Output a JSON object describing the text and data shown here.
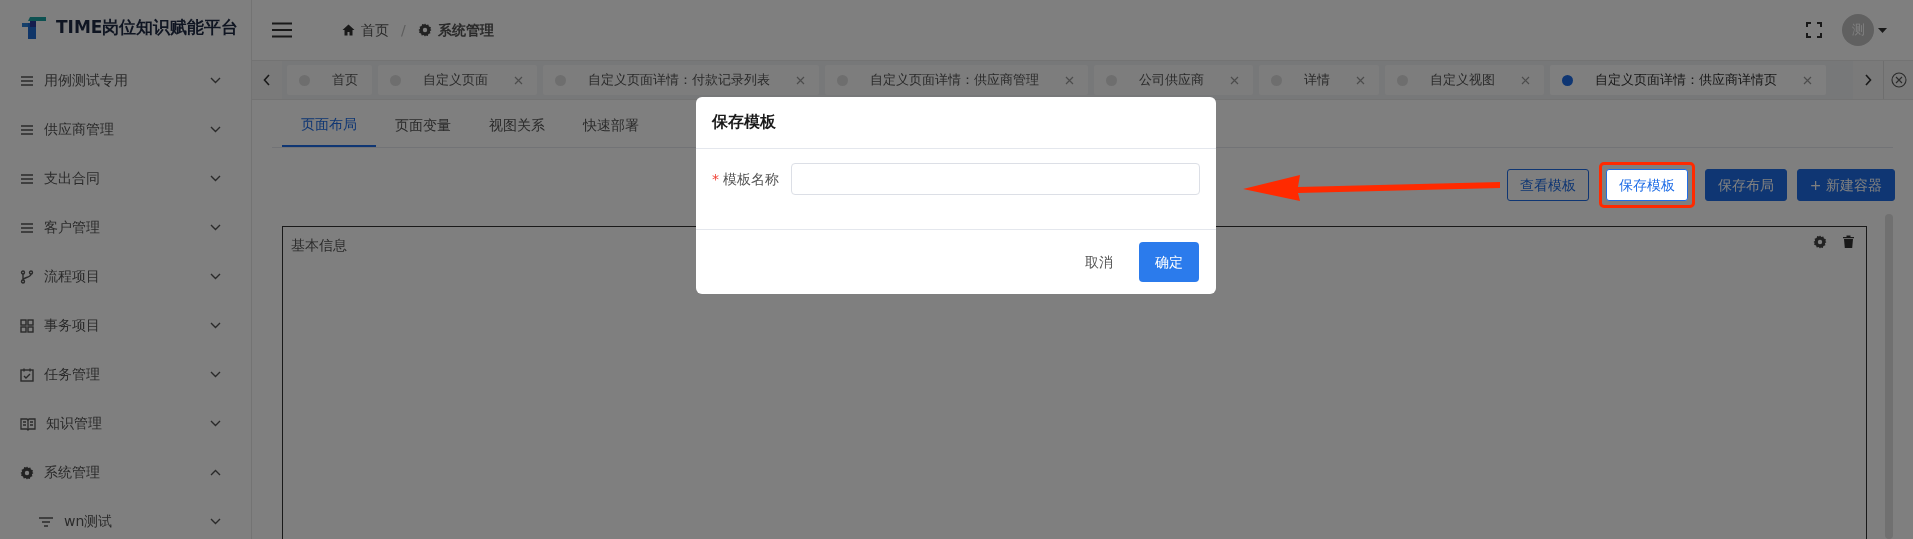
{
  "app": {
    "title": "TIME岗位知识赋能平台"
  },
  "sidebar": {
    "items": [
      {
        "label": "用例测试专用",
        "kind": "menu",
        "expanded": false
      },
      {
        "label": "供应商管理",
        "kind": "menu",
        "expanded": false
      },
      {
        "label": "支出合同",
        "kind": "menu",
        "expanded": false
      },
      {
        "label": "客户管理",
        "kind": "menu",
        "expanded": false
      },
      {
        "label": "流程项目",
        "kind": "branch",
        "expanded": false
      },
      {
        "label": "事务项目",
        "kind": "grid",
        "expanded": false
      },
      {
        "label": "任务管理",
        "kind": "calendar",
        "expanded": false
      },
      {
        "label": "知识管理",
        "kind": "book",
        "expanded": false
      },
      {
        "label": "系统管理",
        "kind": "gear",
        "expanded": true,
        "children": [
          {
            "label": "wn测试",
            "kind": "filter",
            "expanded": false
          }
        ]
      }
    ]
  },
  "breadcrumb": {
    "separator": "/",
    "items": [
      {
        "label": "首页",
        "kind": "home"
      },
      {
        "label": "系统管理",
        "kind": "gear"
      }
    ]
  },
  "user": {
    "avatar_text": "测"
  },
  "page_tabs": [
    {
      "label": "首页",
      "closable": false,
      "selected": false
    },
    {
      "label": "自定义页面",
      "closable": true,
      "selected": false
    },
    {
      "label": "自定义页面详情：付款记录列表",
      "closable": true,
      "selected": false
    },
    {
      "label": "自定义页面详情：供应商管理",
      "closable": true,
      "selected": false
    },
    {
      "label": "公司供应商",
      "closable": true,
      "selected": false
    },
    {
      "label": "详情",
      "closable": true,
      "selected": false
    },
    {
      "label": "自定义视图",
      "closable": true,
      "selected": false
    },
    {
      "label": "自定义页面详情：供应商详情页",
      "closable": true,
      "selected": true
    }
  ],
  "sub_tabs": [
    {
      "label": "页面布局",
      "selected": true
    },
    {
      "label": "页面变量",
      "selected": false
    },
    {
      "label": "视图关系",
      "selected": false
    },
    {
      "label": "快速部署",
      "selected": false
    }
  ],
  "toolbar_buttons": [
    {
      "label": "查看模板",
      "kind": "outline",
      "highlighted": false
    },
    {
      "label": "保存模板",
      "kind": "outline",
      "highlighted": true
    },
    {
      "label": "保存布局",
      "kind": "primary",
      "highlighted": false
    },
    {
      "label": "+ 新建容器",
      "kind": "primary",
      "highlighted": false
    }
  ],
  "panel": {
    "title": "基本信息"
  },
  "modal": {
    "title": "保存模板",
    "field": {
      "label": "模板名称",
      "required_mark": "*"
    },
    "buttons": [
      {
        "label": "取消",
        "kind": "text"
      },
      {
        "label": "确定",
        "kind": "primary"
      }
    ]
  }
}
